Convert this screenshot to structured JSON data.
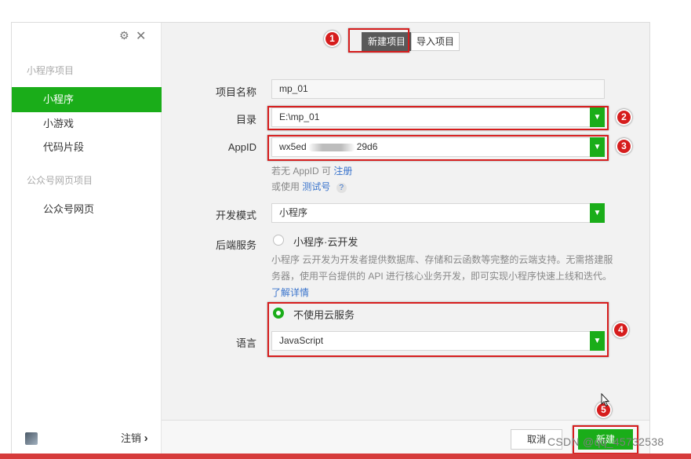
{
  "window_controls": {
    "settings_glyph": "⚙",
    "close_glyph": "✕"
  },
  "sidebar": {
    "section_miniprogram": "小程序项目",
    "items": [
      {
        "label": "小程序",
        "active": true
      },
      {
        "label": "小游戏",
        "active": false
      },
      {
        "label": "代码片段",
        "active": false
      }
    ],
    "section_official": "公众号网页项目",
    "official_item": "公众号网页",
    "logout_label": "注销",
    "logout_chevron": "›"
  },
  "tabs": {
    "new_project": "新建项目",
    "import_project": "导入项目"
  },
  "form": {
    "project_name": {
      "label": "项目名称",
      "value": "mp_01"
    },
    "directory": {
      "label": "目录",
      "value": "E:\\mp_01"
    },
    "appid": {
      "label": "AppID",
      "value_prefix": "wx5ed",
      "value_suffix": "29d6"
    },
    "appid_hint_prefix": "若无 AppID 可",
    "appid_hint_link": "注册",
    "test_hint_prefix": "或使用",
    "test_hint_link": "测试号",
    "help_mark": "?",
    "dev_mode": {
      "label": "开发模式",
      "value": "小程序"
    },
    "backend": {
      "label": "后端服务",
      "option": "小程序·云开发",
      "description": "小程序 云开发为开发者提供数据库、存储和云函数等完整的云端支持。无需搭建服务器，使用平台提供的 API 进行核心业务开发，即可实现小程序快速上线和迭代。",
      "learn_more": "了解详情"
    },
    "no_cloud": {
      "label": "不使用云服务",
      "selected": true
    },
    "language": {
      "label": "语言",
      "value": "JavaScript"
    }
  },
  "footer": {
    "cancel": "取消",
    "create": "新建"
  },
  "annotations": [
    "1",
    "2",
    "3",
    "4",
    "5"
  ],
  "watermark": "CSDN @qq_45732538",
  "colors": {
    "accent_green": "#1aad19",
    "annotation_red": "#d61d1d",
    "link_blue": "#3873cc"
  }
}
